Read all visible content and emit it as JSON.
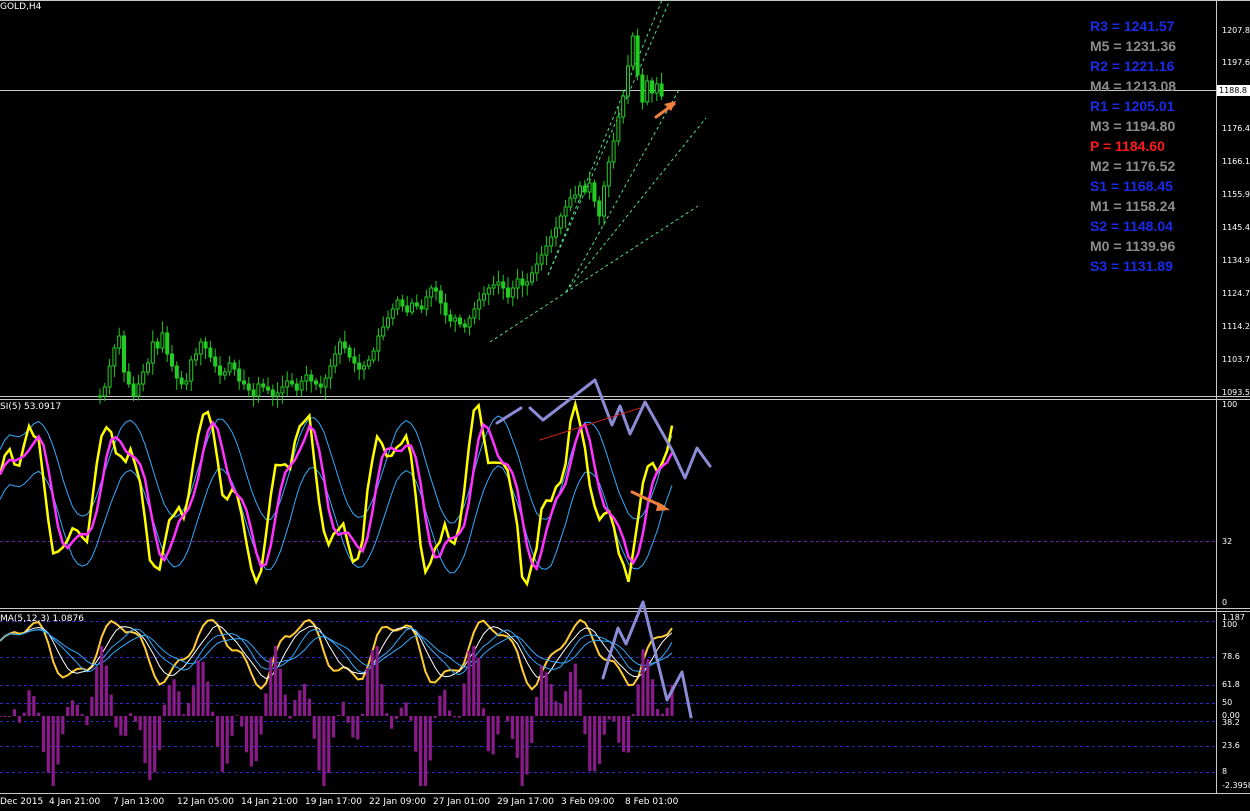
{
  "chart_data": [
    {
      "type": "candlestick",
      "title": "GOLD,H4",
      "price_axis_ticks": [
        "1207.8",
        "1197.6",
        "1176.4",
        "1166.1",
        "1155.9",
        "1145.4",
        "1134.9",
        "1124.7",
        "1114.2",
        "1103.7",
        "1093.5"
      ],
      "current_price": "1188.8",
      "ylim": [
        1090,
        1222
      ],
      "close_path": [
        1090,
        1093,
        1100,
        1106,
        1110,
        1098,
        1094,
        1090,
        1094,
        1098,
        1101,
        1108,
        1106,
        1111,
        1104,
        1100,
        1096,
        1094,
        1095,
        1102,
        1104,
        1108,
        1106,
        1103,
        1100,
        1097,
        1098,
        1101,
        1099,
        1095,
        1094,
        1092,
        1090,
        1094,
        1093,
        1092,
        1090,
        1091,
        1093,
        1095,
        1094,
        1092,
        1095,
        1097,
        1095,
        1094,
        1093,
        1096,
        1100,
        1104,
        1108,
        1106,
        1103,
        1101,
        1099,
        1100,
        1102,
        1105,
        1110,
        1113,
        1116,
        1119,
        1122,
        1120,
        1118,
        1121,
        1120,
        1119,
        1123,
        1126,
        1125,
        1121,
        1117,
        1115,
        1116,
        1114,
        1113,
        1116,
        1119,
        1122,
        1124,
        1126,
        1127,
        1128,
        1126,
        1123,
        1126,
        1129,
        1127,
        1128,
        1131,
        1134,
        1137,
        1140,
        1143,
        1146,
        1150,
        1153,
        1156,
        1157,
        1160,
        1158,
        1161,
        1155,
        1150,
        1160,
        1168,
        1175,
        1183,
        1190,
        1200,
        1210,
        1197,
        1188,
        1195,
        1191,
        1194,
        1190
      ],
      "pivot_levels": [
        {
          "label": "R3 = 1241.57",
          "kind": "R"
        },
        {
          "label": "M5 = 1231.36",
          "kind": "M"
        },
        {
          "label": "R2 = 1221.16",
          "kind": "R"
        },
        {
          "label": "M4 = 1213.08",
          "kind": "M"
        },
        {
          "label": "R1 = 1205.01",
          "kind": "R"
        },
        {
          "label": "M3 = 1194.80",
          "kind": "M"
        },
        {
          "label": "P   = 1184.60",
          "kind": "P"
        },
        {
          "label": "M2 = 1176.52",
          "kind": "M"
        },
        {
          "label": "S1 = 1168.45",
          "kind": "S"
        },
        {
          "label": "M1 = 1158.24",
          "kind": "M"
        },
        {
          "label": "S2 = 1148.04",
          "kind": "S"
        },
        {
          "label": "M0 = 1139.96",
          "kind": "M"
        },
        {
          "label": "S3 = 1131.89",
          "kind": "S"
        }
      ]
    },
    {
      "type": "line",
      "title": "SI(5) 53.0917",
      "ylim": [
        0,
        100
      ],
      "ticks": [
        "100",
        "32",
        "0"
      ],
      "level": 32
    },
    {
      "type": "line",
      "title": "MA(5,12,3) 1.0876",
      "ticks": [
        "1.187",
        "100",
        "78.6",
        "61.8",
        "50",
        "0.00",
        "38.2",
        "23.6",
        "8",
        "-2.3958"
      ],
      "levels": [
        100,
        78.6,
        61.8,
        50,
        38.2,
        23.6,
        8
      ]
    }
  ],
  "time_axis": [
    "Dec 2015",
    "4 Jan 21:00",
    "7 Jan 13:00",
    "12 Jan 05:00",
    "14 Jan 21:00",
    "19 Jan 17:00",
    "22 Jan 09:00",
    "27 Jan 01:00",
    "29 Jan 17:00",
    "3 Feb 09:00",
    "8 Feb 01:00"
  ],
  "colors": {
    "background": "#000000",
    "candles": "#22cc22",
    "pivot_r": "#1a2be8",
    "pivot_s": "#1a2be8",
    "pivot_m": "#8c8c8c",
    "pivot_p": "#ff1a1a",
    "stoch_main": "#ffff00",
    "stoch_signal": "#ff33ff",
    "stoch_bands": "#33aaff",
    "hist": "#8b1a8b",
    "arrow_blue": "#8b8bd6",
    "arrow_orange": "#f08040"
  }
}
